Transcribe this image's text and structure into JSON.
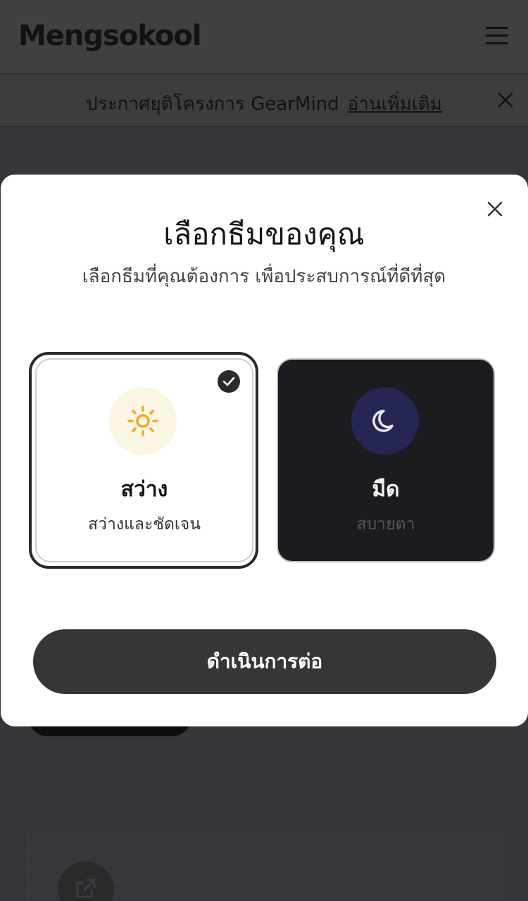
{
  "header": {
    "logo": "Mengsokool",
    "menu_icon": "hamburger-menu-icon"
  },
  "announcement": {
    "text": "ประกาศยุติโครงการ GearMind",
    "link": "อ่านเพิ่มเติม",
    "close_icon": "close-icon"
  },
  "modal": {
    "title": "เลือกธีมของคุณ",
    "subtitle": "เลือกธีมที่คุณต้องการ เพื่อประสบการณ์ที่ดีที่สุด",
    "close_icon": "close-icon",
    "themes": [
      {
        "name": "สว่าง",
        "description": "สว่างและชัดเจน",
        "icon": "sun-icon",
        "selected": true,
        "background": "#ffffff",
        "icon_color": "#f0a92a"
      },
      {
        "name": "มืด",
        "description": "สบายตา",
        "icon": "moon-icon",
        "selected": false,
        "background": "#1b1c20",
        "icon_color": "#e6e6f0"
      }
    ],
    "continue_label": "ดำเนินการต่อ"
  },
  "colors": {
    "overlay": "#37373b",
    "button": "#353637",
    "selected_ring": "#2a2a2a"
  }
}
